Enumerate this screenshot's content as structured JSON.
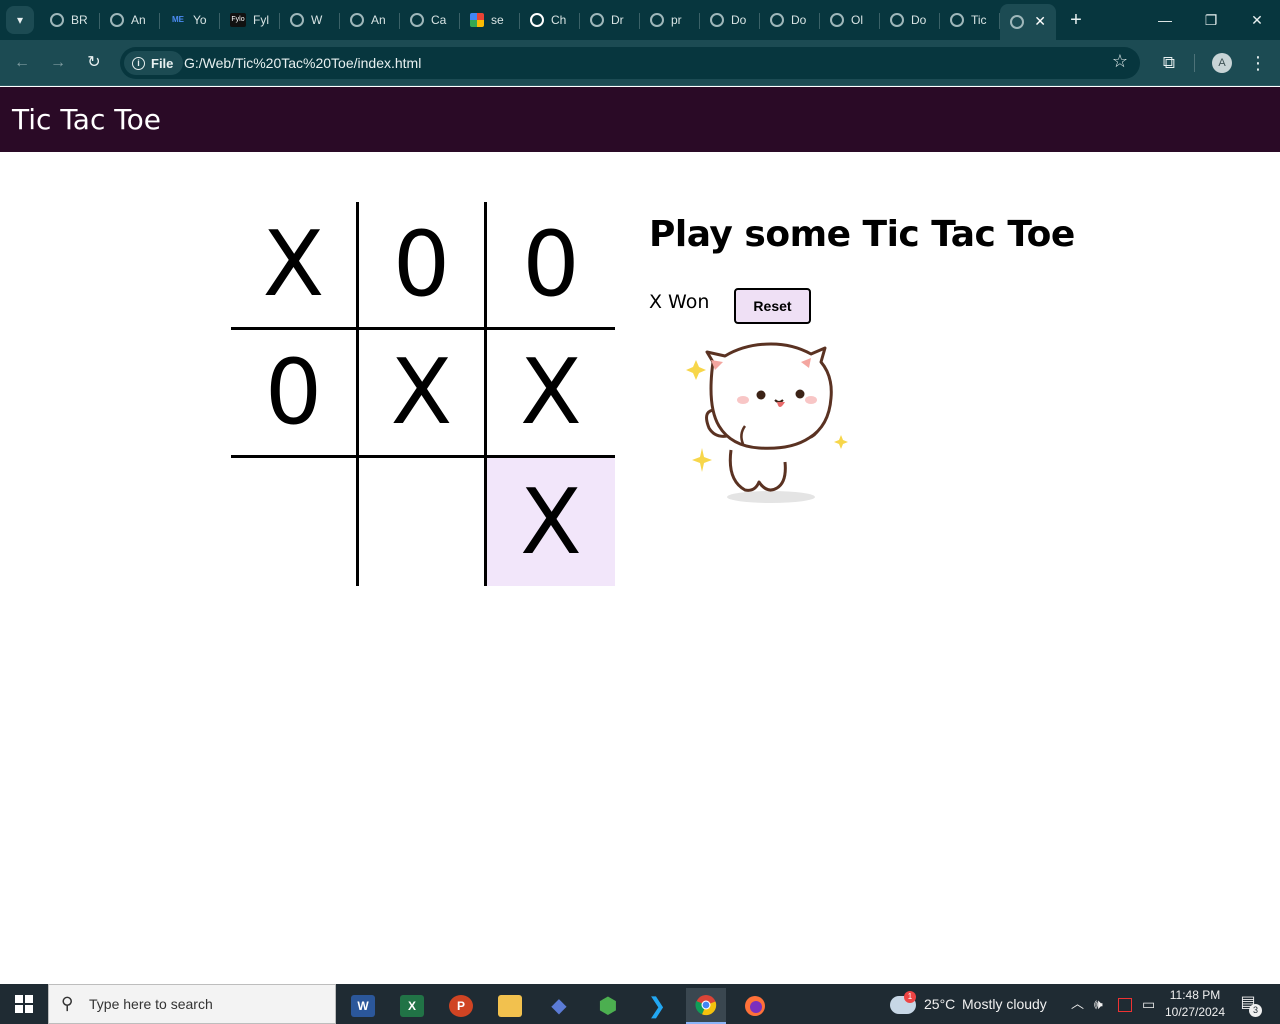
{
  "browser": {
    "tabs": [
      {
        "label": "BR",
        "favicon": "globe-icon"
      },
      {
        "label": "An",
        "favicon": "globe-icon"
      },
      {
        "label": "Yo",
        "favicon": "me-icon",
        "favicon_text": "ME"
      },
      {
        "label": "Fyl",
        "favicon": "fylo-icon",
        "favicon_text": "Fylo"
      },
      {
        "label": "W",
        "favicon": "globe-icon"
      },
      {
        "label": "An",
        "favicon": "globe-icon"
      },
      {
        "label": "Ca",
        "favicon": "globe-icon"
      },
      {
        "label": "se",
        "favicon": "grid-icon"
      },
      {
        "label": "Ch",
        "favicon": "chatgpt-icon"
      },
      {
        "label": "Dr",
        "favicon": "globe-icon"
      },
      {
        "label": "pr",
        "favicon": "globe-icon"
      },
      {
        "label": "Do",
        "favicon": "globe-icon"
      },
      {
        "label": "Do",
        "favicon": "globe-icon"
      },
      {
        "label": "Ol",
        "favicon": "globe-icon"
      },
      {
        "label": "Do",
        "favicon": "globe-icon"
      },
      {
        "label": "Tic",
        "favicon": "globe-icon"
      }
    ],
    "active_tab": {
      "favicon": "globe-icon",
      "close_glyph": "✕"
    },
    "new_tab_glyph": "+",
    "window_controls": {
      "minimize": "—",
      "restore": "❐",
      "close": "✕"
    },
    "site_chip": "File",
    "url": "G:/Web/Tic%20Tac%20Toe/index.html",
    "avatar_letter": "A"
  },
  "page": {
    "header_title": "Tic Tac Toe",
    "heading": "Play some Tic Tac Toe",
    "status": "X Won",
    "reset_label": "Reset",
    "board": [
      [
        "X",
        "0",
        "0"
      ],
      [
        "0",
        "X",
        "X"
      ],
      [
        "",
        "",
        "X"
      ]
    ],
    "highlight_color": "#f2e6fa",
    "header_color": "#2a0a26"
  },
  "taskbar": {
    "search_placeholder": "Type here to search",
    "apps": [
      {
        "name": "word-icon",
        "glyph": "W",
        "color": "#2b579a"
      },
      {
        "name": "excel-icon",
        "glyph": "X",
        "color": "#217346"
      },
      {
        "name": "powerpoint-icon",
        "glyph": "P",
        "color": "#d04423"
      },
      {
        "name": "file-explorer-icon",
        "glyph": "",
        "color": "#f2c14e"
      },
      {
        "name": "git-icon",
        "glyph": "◆",
        "color": "#5b7bd5"
      },
      {
        "name": "nodejs-icon",
        "glyph": "⬢",
        "color": "#4caf50"
      },
      {
        "name": "vscode-icon",
        "glyph": "❯",
        "color": "#0078d4"
      },
      {
        "name": "chrome-icon",
        "glyph": "",
        "color": "#4285f4"
      },
      {
        "name": "firefox-icon",
        "glyph": "",
        "color": "#ff7139"
      }
    ],
    "weather_temp": "25°C",
    "weather_text": "Mostly cloudy",
    "weather_badge": "1",
    "time": "11:48 PM",
    "date": "10/27/2024",
    "notification_count": "3"
  }
}
